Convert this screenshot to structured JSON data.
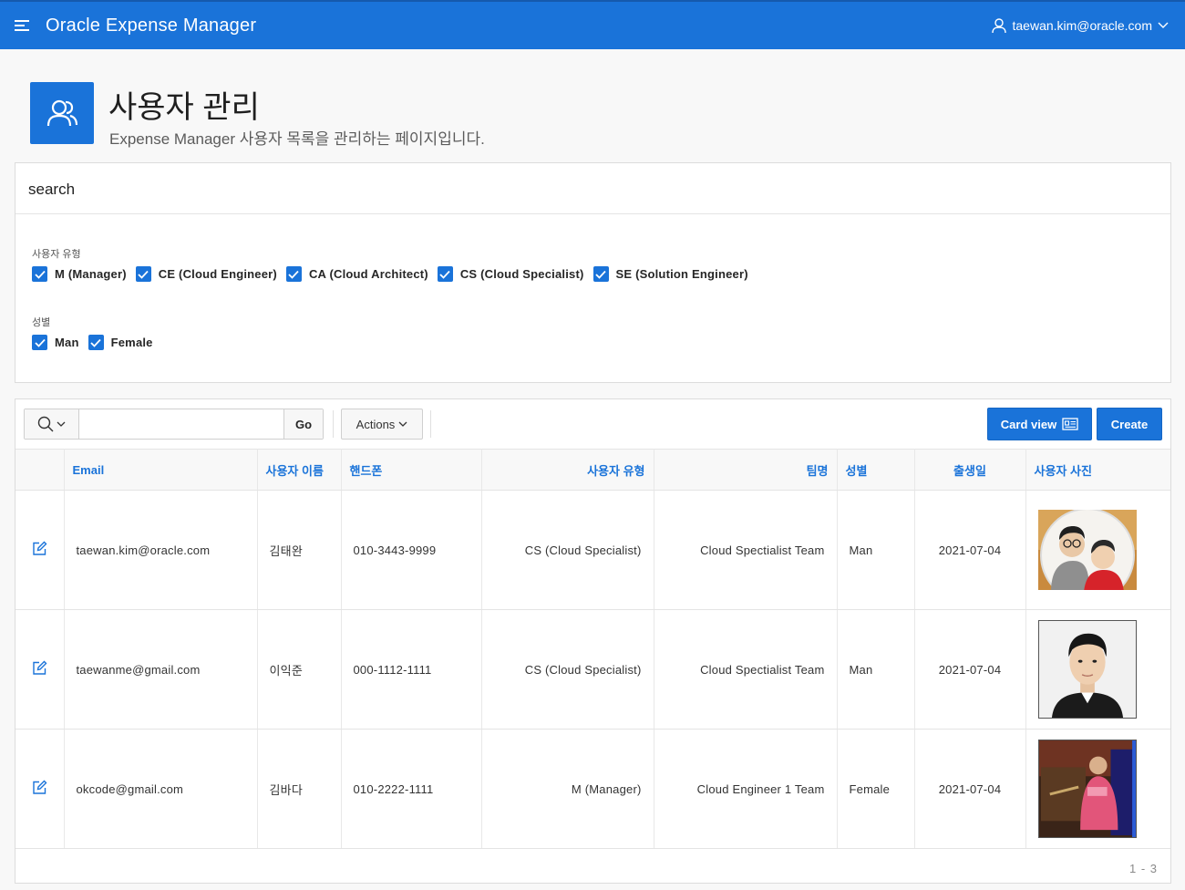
{
  "header": {
    "app_title": "Oracle Expense Manager",
    "user_email": "taewan.kim@oracle.com",
    "icons": {
      "menu": "hamburger-icon",
      "user": "user-icon",
      "dropdown": "chevron-down-icon"
    }
  },
  "hero": {
    "title": "사용자 관리",
    "description": "Expense Manager 사용자 목록을 관리하는 페이지입니다.",
    "icon": "users-icon"
  },
  "search": {
    "header": "search",
    "facets": [
      {
        "label": "사용자 유형",
        "options": [
          {
            "label": "M (Manager)",
            "checked": true
          },
          {
            "label": "CE (Cloud Engineer)",
            "checked": true
          },
          {
            "label": "CA (Cloud Architect)",
            "checked": true
          },
          {
            "label": "CS (Cloud Specialist)",
            "checked": true
          },
          {
            "label": "SE (Solution Engineer)",
            "checked": true
          }
        ]
      },
      {
        "label": "성별",
        "options": [
          {
            "label": "Man",
            "checked": true
          },
          {
            "label": "Female",
            "checked": true
          }
        ]
      }
    ]
  },
  "toolbar": {
    "search_value": "",
    "go_label": "Go",
    "actions_label": "Actions",
    "card_view_label": "Card view",
    "create_label": "Create",
    "accent_color": "#1a73d9"
  },
  "table": {
    "columns": [
      "Email",
      "사용자 이름",
      "핸드폰",
      "사용자 유형",
      "팀명",
      "성별",
      "출생일",
      "사용자 사진"
    ],
    "rows": [
      {
        "email": "taewan.kim@oracle.com",
        "name": "김태완",
        "phone": "010-3443-9999",
        "type": "CS (Cloud Specialist)",
        "team": "Cloud Spectialist Team",
        "gender": "Man",
        "birth": "2021-07-04",
        "photo": "photo-round-portrait"
      },
      {
        "email": "taewanme@gmail.com",
        "name": "이익준",
        "phone": "000-1112-1111",
        "type": "CS (Cloud Specialist)",
        "team": "Cloud Spectialist Team",
        "gender": "Man",
        "birth": "2021-07-04",
        "photo": "photo-headshot"
      },
      {
        "email": "okcode@gmail.com",
        "name": "김바다",
        "phone": "010-2222-1111",
        "type": "M (Manager)",
        "team": "Cloud Engineer 1 Team",
        "gender": "Female",
        "birth": "2021-07-04",
        "photo": "photo-presenter"
      }
    ],
    "pagination": "1 - 3"
  }
}
